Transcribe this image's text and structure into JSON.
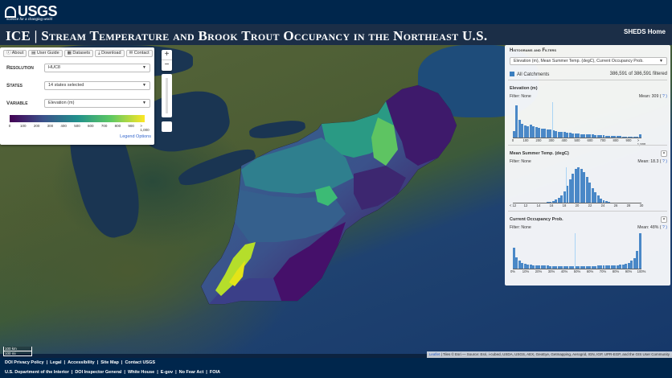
{
  "header": {
    "logo_text": "USGS",
    "logo_tagline": "science for a changing world",
    "title": "ICE | Stream Temperature and Brook Trout Occupancy in the Northeast U.S.",
    "home_link": "SHEDS Home"
  },
  "left_panel": {
    "nav": [
      "About",
      "User Guide",
      "Datasets",
      "Download",
      "Contact"
    ],
    "resolution": {
      "label": "Resolution",
      "value": "HUC8"
    },
    "states": {
      "label": "States",
      "value": "14 states selected"
    },
    "variable": {
      "label": "Variable",
      "value": "Elevation (m)"
    },
    "colorbar_ticks": [
      "0",
      "100",
      "200",
      "300",
      "400",
      "500",
      "600",
      "700",
      "800",
      "900",
      "> 1,000"
    ],
    "legend_options": "Legend Options"
  },
  "map_controls": {
    "zoom_in": "+",
    "zoom_out": "−"
  },
  "right_panel": {
    "title": "Histograms and Filters",
    "selected_vars": "Elevation (m), Mean Summer Temp. (degC), Current Occupancy Prob.",
    "all_catchments": "All Catchments",
    "filtered_count": "386,591 of 386,591 filtered",
    "histograms": [
      {
        "name": "Elevation (m)",
        "filter": "Filter: None",
        "mean": "Mean: 309 (",
        "ticks": [
          "0",
          "100",
          "200",
          "300",
          "400",
          "500",
          "600",
          "700",
          "800",
          "900",
          "> 1,000"
        ],
        "bars": [
          0.18,
          0.92,
          0.5,
          0.38,
          0.34,
          0.32,
          0.36,
          0.32,
          0.3,
          0.28,
          0.26,
          0.26,
          0.22,
          0.22,
          0.2,
          0.18,
          0.17,
          0.16,
          0.15,
          0.14,
          0.13,
          0.12,
          0.12,
          0.11,
          0.1,
          0.1,
          0.09,
          0.08,
          0.08,
          0.07,
          0.07,
          0.06,
          0.06,
          0.05,
          0.05,
          0.05,
          0.04,
          0.04,
          0.04,
          0.03,
          0.03,
          0.03,
          0.03,
          0.03,
          0.02,
          0.08
        ],
        "mean_value": 309,
        "range": [
          0,
          1000
        ]
      },
      {
        "name": "Mean Summer Temp. (degC)",
        "filter": "Filter: None",
        "mean": "Mean: 18.3 (",
        "ticks": [
          "< 12",
          "12",
          "14",
          "16",
          "18",
          "20",
          "22",
          "24",
          "26",
          "28",
          "30"
        ],
        "bars": [
          0.0,
          0.0,
          0.0,
          0.0,
          0.0,
          0.0,
          0.0,
          0.0,
          0.0,
          0.0,
          0.0,
          0.01,
          0.02,
          0.03,
          0.05,
          0.08,
          0.13,
          0.2,
          0.32,
          0.48,
          0.66,
          0.82,
          0.95,
          1.0,
          0.96,
          0.86,
          0.72,
          0.56,
          0.42,
          0.3,
          0.2,
          0.12,
          0.07,
          0.04,
          0.02,
          0.01,
          0.0,
          0.0,
          0.0,
          0.0,
          0.0,
          0.0,
          0.0,
          0.0,
          0.0,
          0.0
        ],
        "mean_value": 18.3,
        "range": [
          10,
          30
        ]
      },
      {
        "name": "Current Occupancy Prob.",
        "filter": "Filter: None",
        "mean": "Mean: 48% (",
        "ticks": [
          "0%",
          "10%",
          "20%",
          "30%",
          "40%",
          "50%",
          "60%",
          "70%",
          "80%",
          "90%",
          "100%"
        ],
        "bars": [
          0.6,
          0.32,
          0.22,
          0.17,
          0.14,
          0.12,
          0.11,
          0.1,
          0.09,
          0.09,
          0.08,
          0.08,
          0.08,
          0.07,
          0.07,
          0.07,
          0.07,
          0.07,
          0.07,
          0.07,
          0.07,
          0.07,
          0.07,
          0.07,
          0.07,
          0.07,
          0.07,
          0.07,
          0.07,
          0.07,
          0.08,
          0.08,
          0.08,
          0.08,
          0.09,
          0.09,
          0.1,
          0.1,
          0.11,
          0.12,
          0.14,
          0.17,
          0.22,
          0.3,
          0.5,
          1.0
        ],
        "mean_value": 48,
        "range": [
          0,
          100
        ]
      }
    ],
    "close_glyph": "×",
    "question_glyph": "?"
  },
  "map": {
    "scale_km": "100 km",
    "scale_mi": "100 mi",
    "attribution_leaflet": "Leaflet",
    "attribution_rest": " | Tiles © Esri — Source: Esri, i-cubed, USDA, USGS, AEX, GeoEye, Getmapping, Aerogrid, IGN, IGP, UPR-EGP, and the GIS User Community"
  },
  "footer": {
    "row1": [
      "DOI Privacy Policy",
      "Legal",
      "Accessibility",
      "Site Map",
      "Contact USGS"
    ],
    "row2": [
      "U.S. Department of the Interior",
      "DOI Inspector General",
      "White House",
      "E-gov",
      "No Fear Act",
      "FOIA"
    ]
  },
  "colors": {
    "navy": "#00264c",
    "bar": "#4a88c7",
    "link": "#3366cc"
  }
}
